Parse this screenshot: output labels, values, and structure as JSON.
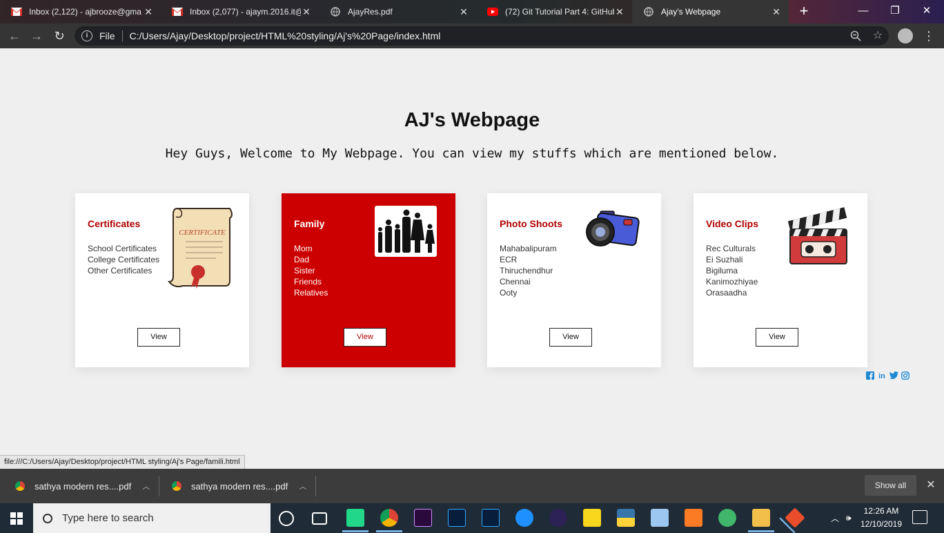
{
  "browser": {
    "tabs": [
      {
        "title": "Inbox (2,122) - ajbrooze@gma",
        "favicon": "gmail-icon"
      },
      {
        "title": "Inbox (2,077) - ajaym.2016.it@",
        "favicon": "gmail-icon"
      },
      {
        "title": "AjayRes.pdf",
        "favicon": "globe-icon"
      },
      {
        "title": "(72) Git Tutorial Part 4: GitHub",
        "favicon": "youtube-icon"
      },
      {
        "title": "Ajay's Webpage",
        "favicon": "globe-icon"
      }
    ],
    "scheme_label": "File",
    "url": "C:/Users/Ajay/Desktop/project/HTML%20styling/Aj's%20Page/index.html"
  },
  "page": {
    "title": "AJ's Webpage",
    "welcome": "Hey Guys, Welcome to My Webpage. You can view my stuffs which are mentioned below.",
    "cards": [
      {
        "heading": "Certificates",
        "items": [
          "School Certificates",
          "College Certificates",
          "Other Certificates"
        ],
        "button": "View",
        "highlighted": false
      },
      {
        "heading": "Family",
        "items": [
          "Mom",
          "Dad",
          "Sister",
          "Friends",
          "Relatives"
        ],
        "button": "View",
        "highlighted": true
      },
      {
        "heading": "Photo Shoots",
        "items": [
          "Mahabalipuram",
          "ECR",
          "Thiruchendhur",
          "Chennai",
          "Ooty"
        ],
        "button": "View",
        "highlighted": false
      },
      {
        "heading": "Video Clips",
        "items": [
          "Rec Culturals",
          "Ei Suzhali",
          "Bigiluma",
          "Kanimozhiyae",
          "Orasaadha"
        ],
        "button": "View",
        "highlighted": false
      }
    ],
    "social_icons": [
      "facebook-icon",
      "linkedin-icon",
      "twitter-icon",
      "instagram-icon"
    ],
    "accent_color": "#cc0000",
    "certificate_image_text": "CERTIFICATE"
  },
  "status_bar": {
    "link": "file:///C:/Users/Ajay/Desktop/project/HTML styling/Aj's Page/famili.html"
  },
  "downloads": {
    "items": [
      "sathya modern res....pdf",
      "sathya modern res....pdf"
    ],
    "show_all": "Show all"
  },
  "taskbar": {
    "search_placeholder": "Type here to search",
    "time": "12:26 AM",
    "date": "12/10/2019"
  }
}
